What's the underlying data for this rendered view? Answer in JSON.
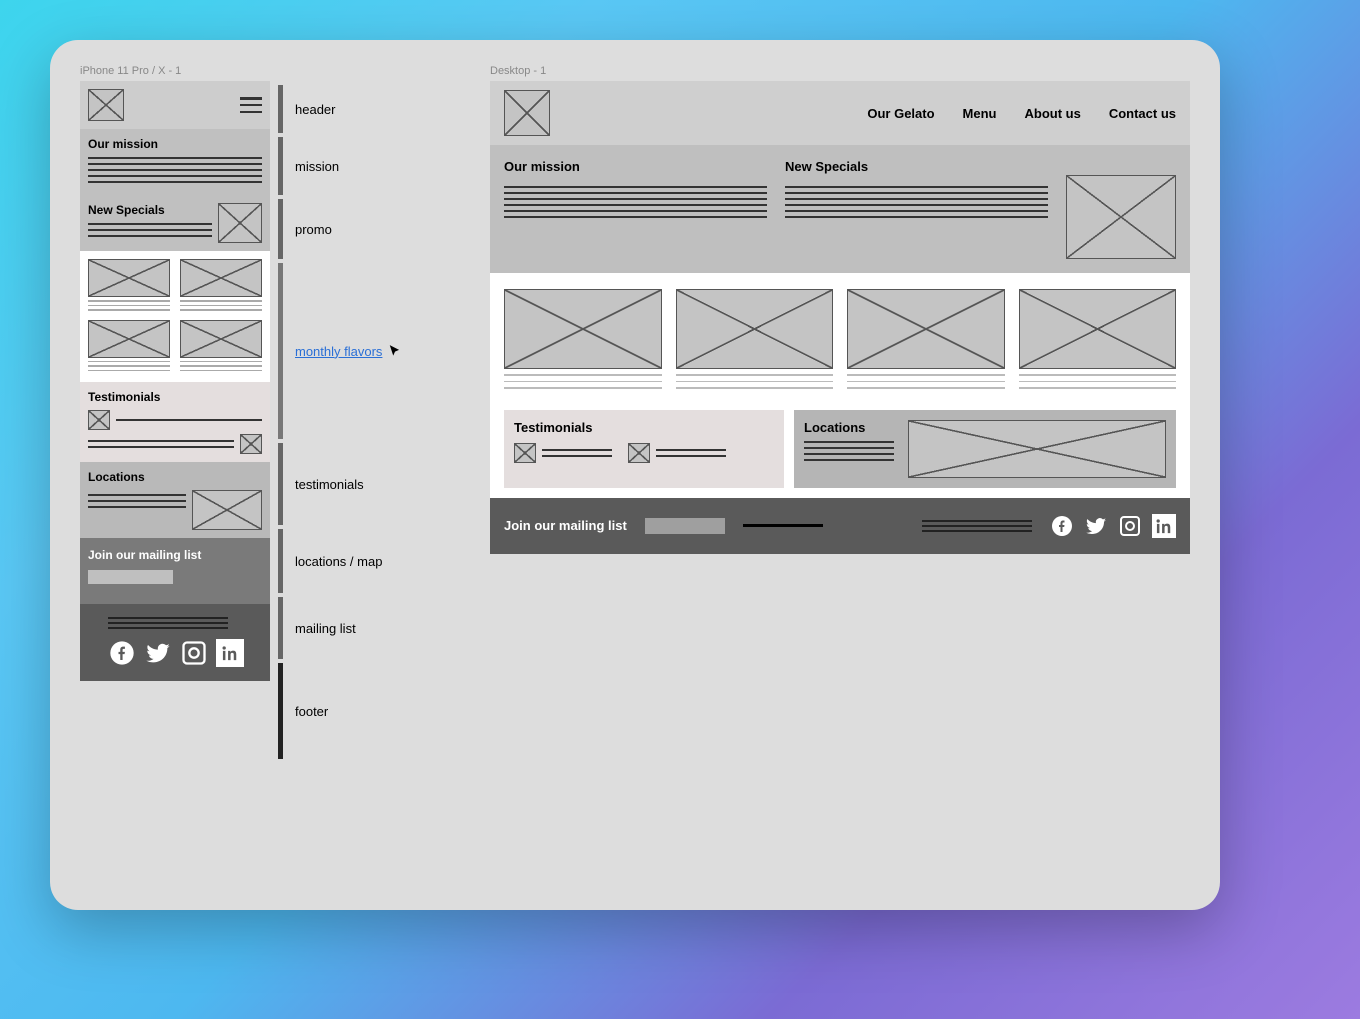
{
  "frames": {
    "mobile_label": "iPhone 11 Pro / X - 1",
    "desktop_label": "Desktop - 1"
  },
  "annotations": {
    "header": "header",
    "mission": "mission",
    "promo": "promo",
    "monthly_flavors": "monthly flavors",
    "testimonials": "testimonials",
    "locations_map": "locations / map",
    "mailing_list": "mailing list",
    "footer": "footer"
  },
  "nav": {
    "our_gelato": "Our Gelato",
    "menu": "Menu",
    "about_us": "About us",
    "contact_us": "Contact us"
  },
  "headings": {
    "our_mission": "Our mission",
    "new_specials": "New Specials",
    "testimonials": "Testimonials",
    "locations": "Locations",
    "mailing": "Join our mailing list"
  },
  "colors": {
    "link": "#2a6fd6"
  }
}
